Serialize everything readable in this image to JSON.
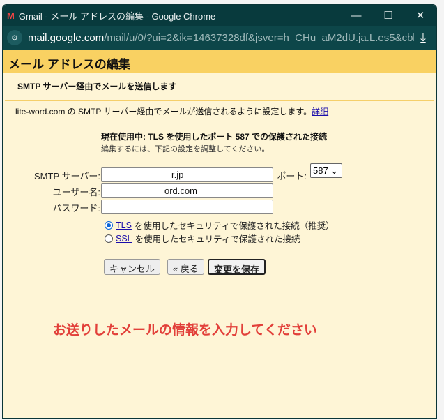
{
  "window": {
    "title": "Gmail - メール アドレスの編集 - Google Chrome",
    "gmail_icon": "M",
    "minimize": "—",
    "maximize": "☐",
    "close": "✕"
  },
  "address": {
    "domain": "mail.google.com",
    "path": "/mail/u/0/?ui=2&ik=14637328df&jsver=h_CHu_aM2dU.ja.L.es5&cbl...",
    "download_icon": "⤓"
  },
  "dialog": {
    "header": "メール アドレスの編集",
    "subtitle": "SMTP サーバー経由でメールを送信します",
    "description": "lite-word.com の SMTP サーバー経由でメールが送信されるように設定します。",
    "details_link": "詳細",
    "current": "現在使用中: TLS を使用したポート 587 での保護された接続",
    "hint": "編集するには、下記の設定を調整してください。",
    "smtp_label": "SMTP サーバー:",
    "smtp_value": "r.jp",
    "port_label": "ポート:",
    "port_value": "587 ⌄",
    "user_label": "ユーザー名:",
    "user_value": "ord.com",
    "password_label": "パスワード:",
    "password_value": "",
    "tls_link": "TLS",
    "tls_text": "を使用したセキュリティで保護された接続（推奨）",
    "ssl_link": "SSL",
    "ssl_text": "を使用したセキュリティで保護された接続",
    "cancel": "キャンセル",
    "back": "« 戻る",
    "save": "変更を保存"
  },
  "annotation": "お送りしたメールの情報を入力してください"
}
